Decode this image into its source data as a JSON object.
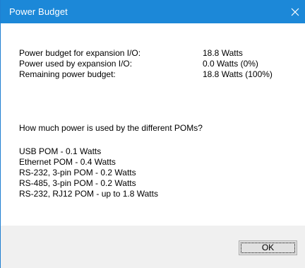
{
  "window": {
    "title": "Power Budget",
    "close_icon": "close-icon"
  },
  "budget": [
    {
      "label": "Power budget for expansion I/O:",
      "value": "18.8 Watts"
    },
    {
      "label": "Power used by expansion I/O:",
      "value": "0.0 Watts  (0%)"
    },
    {
      "label": "Remaining power budget:",
      "value": "18.8 Watts  (100%)"
    }
  ],
  "question": "How much power is used by the different POMs?",
  "poms": [
    "USB POM - 0.1 Watts",
    "Ethernet POM - 0.4 Watts",
    "RS-232, 3-pin POM - 0.2 Watts",
    "RS-485, 3-pin POM - 0.2 Watts",
    "RS-232, RJ12 POM - up to 1.8 Watts"
  ],
  "footer": {
    "ok_label": "OK"
  }
}
